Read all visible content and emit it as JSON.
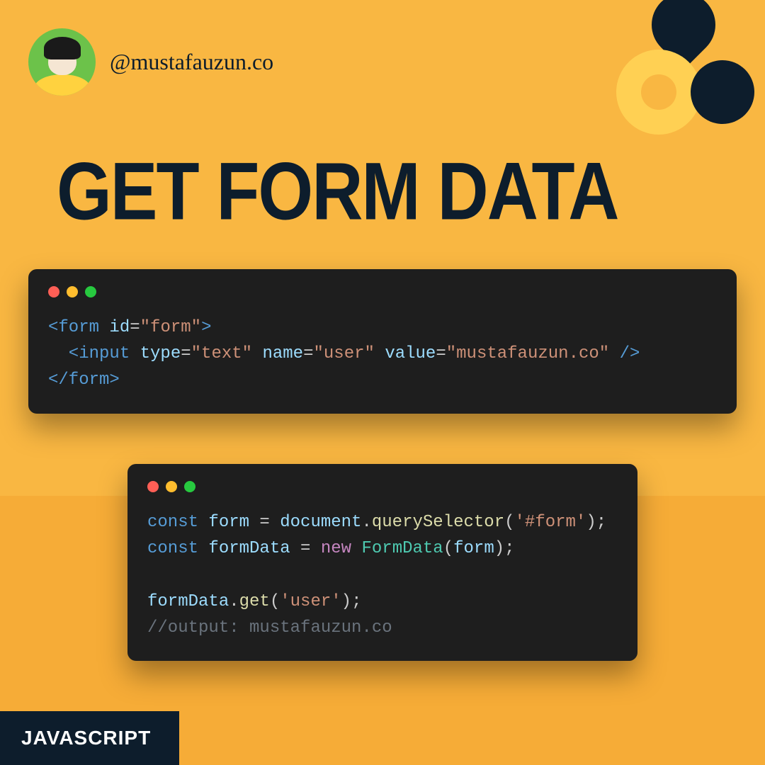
{
  "handle": "@mustafauzun.co",
  "title": "GET FORM DATA",
  "tag": "JAVASCRIPT",
  "code1": {
    "l1a": "<form",
    "l1b": "id",
    "l1c": "=",
    "l1d": "\"form\"",
    "l1e": ">",
    "l2a": "  <input",
    "l2b": "type",
    "l2c": "=",
    "l2d": "\"text\"",
    "l2e": "name",
    "l2f": "=",
    "l2g": "\"user\"",
    "l2h": "value",
    "l2i": "=",
    "l2j": "\"mustafauzun.co\"",
    "l2k": " />",
    "l3a": "</form>"
  },
  "code2": {
    "l1a": "const",
    "l1b": "form",
    "l1c": " = ",
    "l1d": "document",
    "l1e": ".",
    "l1f": "querySelector",
    "l1g": "(",
    "l1h": "'#form'",
    "l1i": ");",
    "l2a": "const",
    "l2b": "formData",
    "l2c": " = ",
    "l2d": "new",
    "l2e": "FormData",
    "l2f": "(",
    "l2g": "form",
    "l2h": ");",
    "l4a": "formData",
    "l4b": ".",
    "l4c": "get",
    "l4d": "(",
    "l4e": "'user'",
    "l4f": ");",
    "l5a": "//output: mustafauzun.co"
  }
}
